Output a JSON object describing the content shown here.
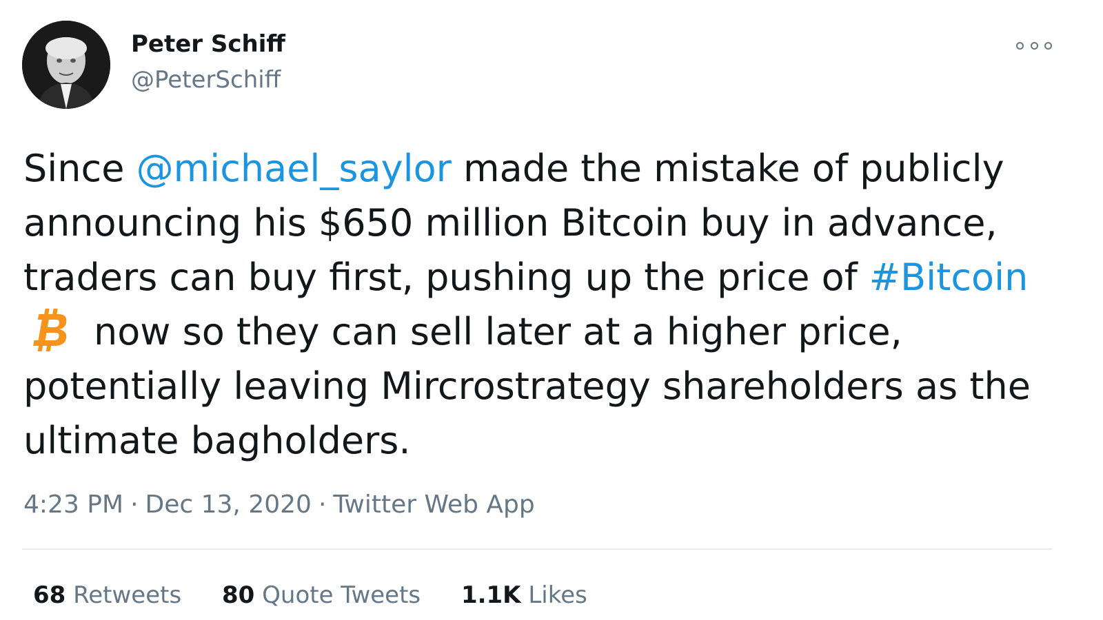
{
  "author": {
    "display_name": "Peter Schiff",
    "handle": "@PeterSchiff"
  },
  "tweet": {
    "line1_pre": "Since ",
    "mention": "@michael_saylor",
    "line1_post": " made the mistake of publicly",
    "line2": "announcing his $650 million Bitcoin buy in advance,",
    "line3_pre": "traders can buy first, pushing up the price of ",
    "hashtag": "#Bitcoin",
    "line4": "now so they can sell later at a higher price,",
    "line5": "potentially leaving Mircrostrategy shareholders as the",
    "line6": "ultimate bagholders."
  },
  "meta": {
    "time": "4:23 PM",
    "separator": "·",
    "date": "Dec 13, 2020",
    "source": "Twitter Web App"
  },
  "stats": [
    {
      "count": "68",
      "label": "Retweets"
    },
    {
      "count": "80",
      "label": "Quote Tweets"
    },
    {
      "count": "1.1K",
      "label": "Likes"
    }
  ],
  "icons": {
    "more": "more-options-icon",
    "bitcoin": "bitcoin-emoji-icon"
  },
  "colors": {
    "link": "#1b95e0",
    "secondary_text": "#657786",
    "primary_text": "#14171a",
    "bitcoin_orange": "#f7931a"
  }
}
